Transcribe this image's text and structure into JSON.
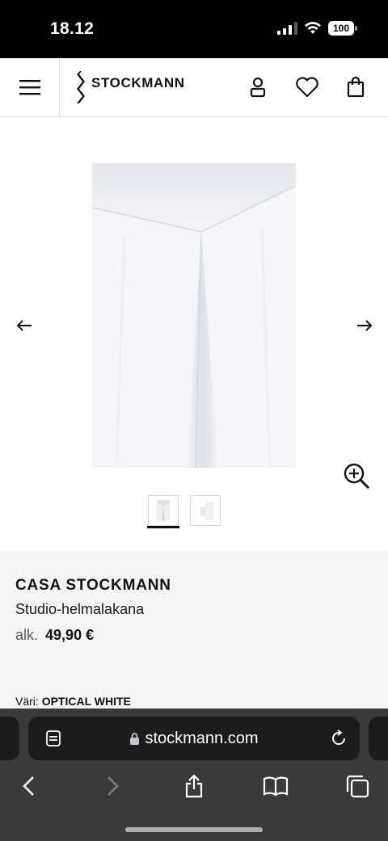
{
  "status_bar": {
    "time": "18.12",
    "battery": "100"
  },
  "header": {
    "brand_logo": "STOCKMANN",
    "icons": [
      "menu-icon",
      "account-icon",
      "heart-icon",
      "bag-icon"
    ]
  },
  "gallery": {
    "thumbnail_count": 2,
    "active_thumbnail": 1
  },
  "product": {
    "brand": "CASA STOCKMANN",
    "name": "Studio-helmalakana",
    "price_prefix": "alk.",
    "price": "49,90 €",
    "color_label": "Väri:",
    "color_value": "OPTICAL WHITE"
  },
  "browser": {
    "url": "stockmann.com"
  },
  "colors": {
    "status_bar": "#000000",
    "info_bg": "#f4f5f7",
    "safari_bar": "#3a3a3c",
    "address_bg": "#1c1c1e"
  }
}
